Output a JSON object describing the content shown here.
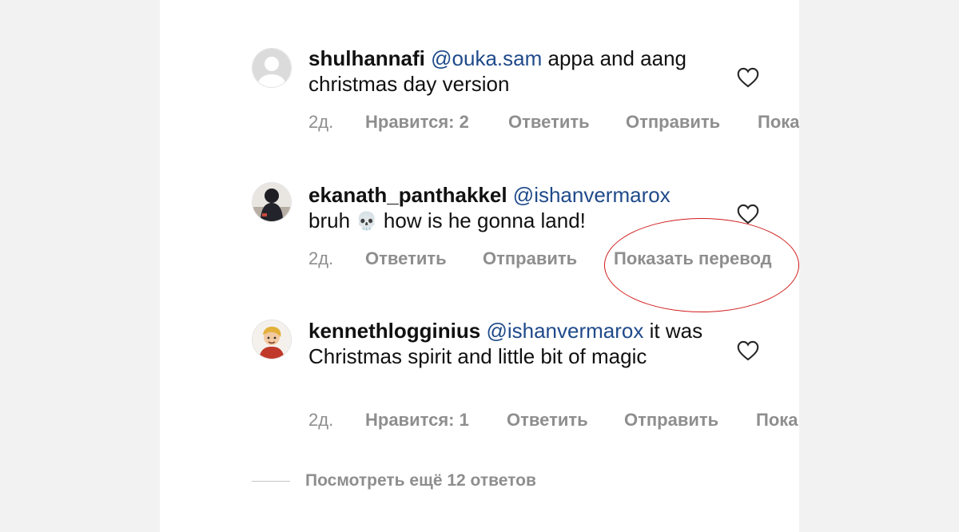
{
  "comments": [
    {
      "username": "shulhannafi",
      "mention": "@ouka.sam",
      "text": "appa and aang christmas day version",
      "time": "2д.",
      "likes": "Нравится: 2",
      "reply": "Ответить",
      "send": "Отправить",
      "translate_partial": "Пока"
    },
    {
      "username": "ekanath_panthakkel",
      "mention": "@ishanvermarox",
      "text_before": "bruh",
      "emoji": "💀",
      "text_after": "how is he gonna land!",
      "time": "2д.",
      "reply": "Ответить",
      "send": "Отправить",
      "translate": "Показать перевод"
    },
    {
      "username": "kennethlogginius",
      "mention": "@ishanvermarox",
      "text": "it was Christmas spirit and little bit of magic",
      "time": "2д.",
      "likes": "Нравится: 1",
      "reply": "Ответить",
      "send": "Отправить",
      "translate_partial": "Пока"
    }
  ],
  "view_more": "Посмотреть ещё 12 ответов",
  "colors": {
    "mention": "#1f4a8a",
    "meta": "#8e8e8e",
    "annotation": "#d11a1a"
  },
  "icons": {
    "like": "heart-outline-icon",
    "avatar_placeholder": "default-avatar-icon"
  }
}
